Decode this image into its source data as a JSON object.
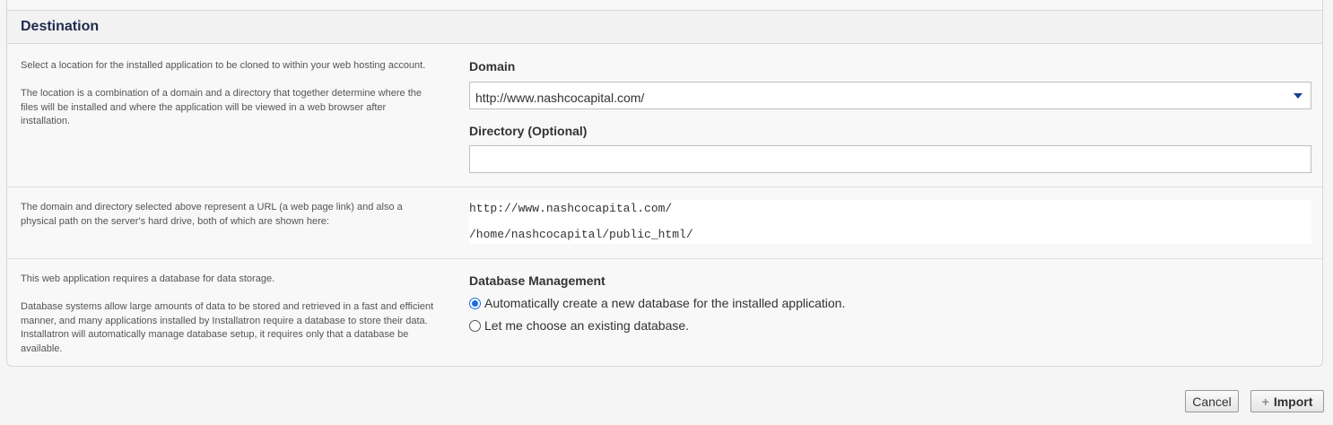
{
  "section": {
    "title": "Destination"
  },
  "location": {
    "desc_p1": "Select a location for the installed application to be cloned to within your web hosting account.",
    "desc_p2": "The location is a combination of a domain and a directory that together determine where the files will be installed and where the application will be viewed in a web browser after installation.",
    "domain_label": "Domain",
    "domain_value": "http://www.nashcocapital.com/",
    "directory_label": "Directory (Optional)",
    "directory_value": ""
  },
  "paths": {
    "desc": "The domain and directory selected above represent a URL (a web page link) and also a physical path on the server's hard drive, both of which are shown here:",
    "url": "http://www.nashcocapital.com/",
    "path": "/home/nashcocapital/public_html/"
  },
  "database": {
    "desc_p1": "This web application requires a database for data storage.",
    "desc_p2": "Database systems allow large amounts of data to be stored and retrieved in a fast and efficient manner, and many applications installed by Installatron require a database to store their data. Installatron will automatically manage database setup, it requires only that a database be available.",
    "label": "Database Management",
    "option_auto": "Automatically create a new database for the installed application.",
    "option_existing": "Let me choose an existing database.",
    "selected": "auto"
  },
  "actions": {
    "cancel_label": "Cancel",
    "import_label": "Import",
    "import_icon": "plus-icon"
  }
}
